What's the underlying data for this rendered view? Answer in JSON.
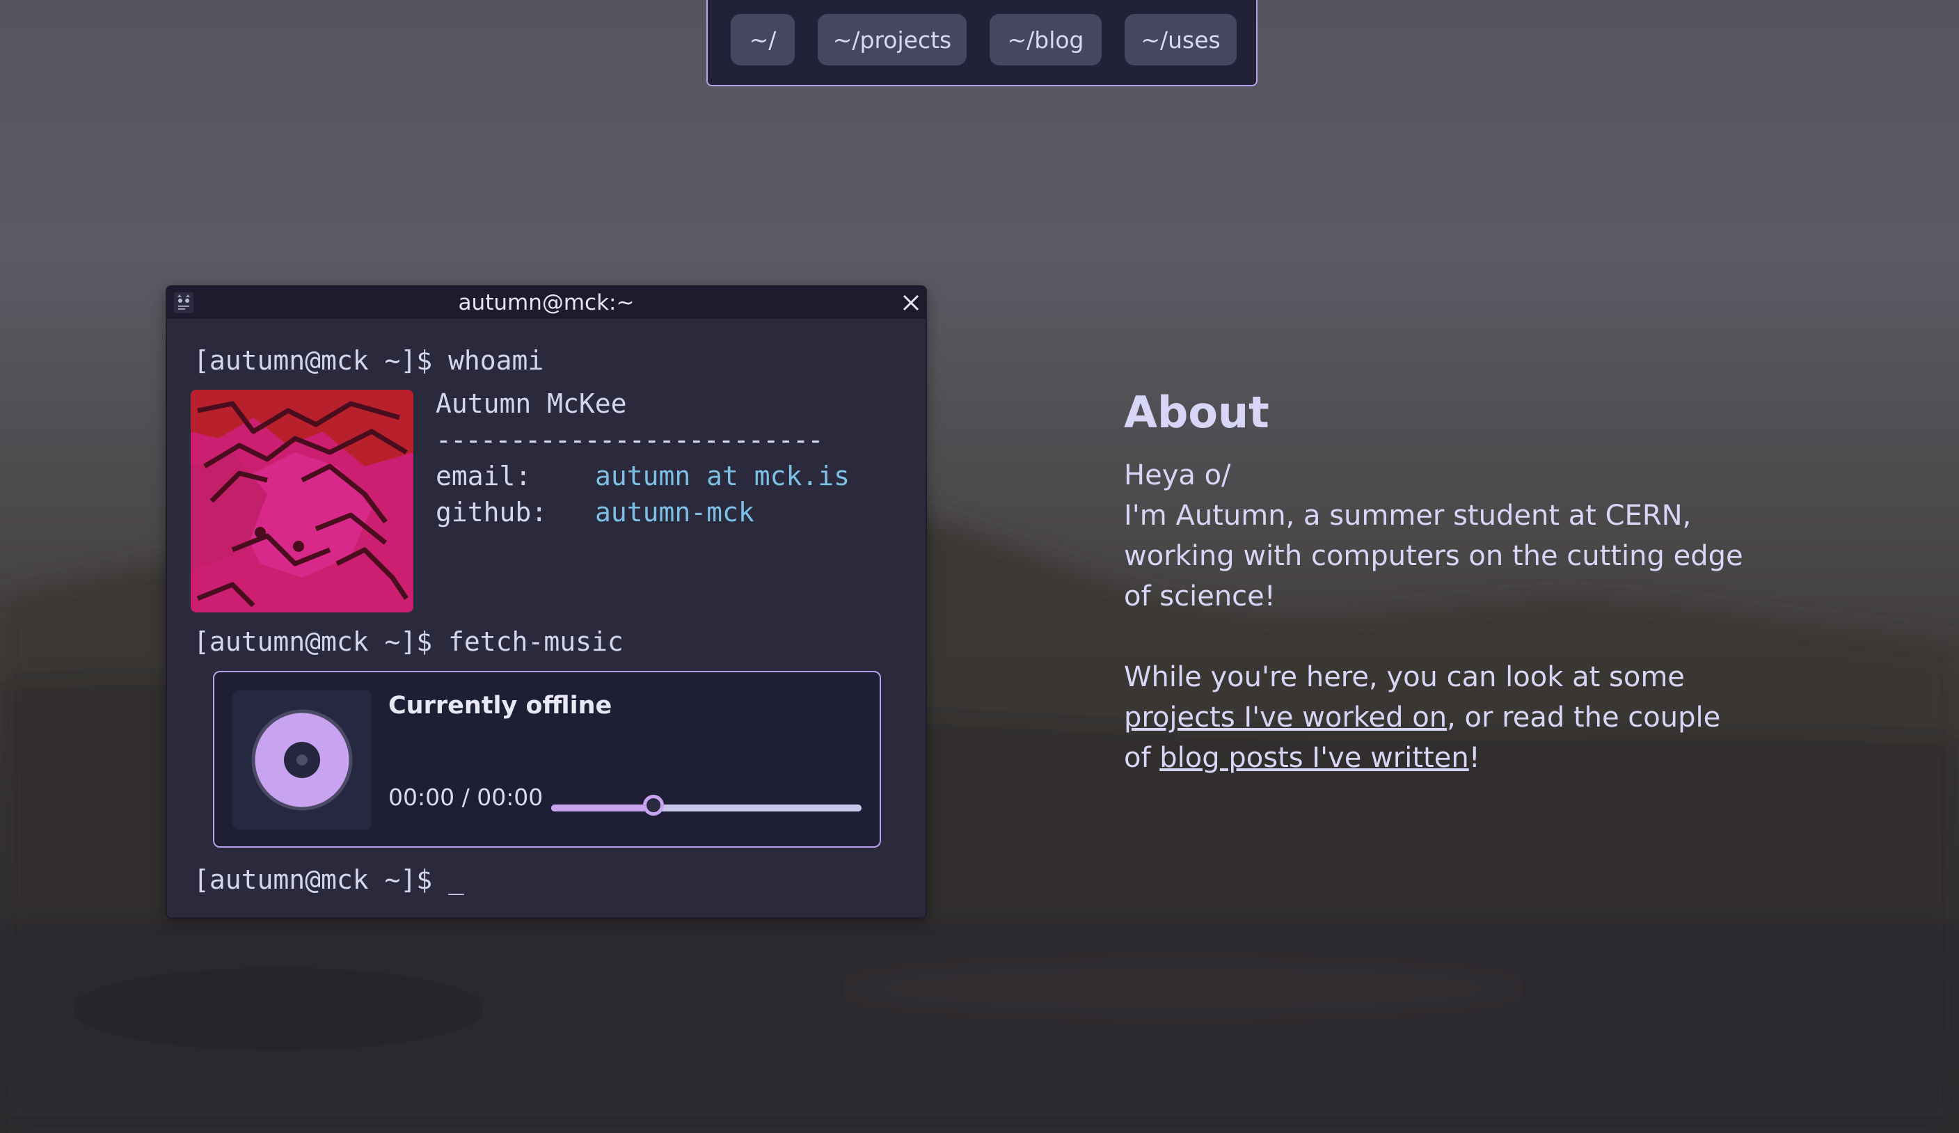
{
  "nav": {
    "home": "~/",
    "projects": "~/projects",
    "blog": "~/blog",
    "uses": "~/uses"
  },
  "terminal": {
    "title": "autumn@mck:~",
    "prompt1": "[autumn@mck ~]$ whoami",
    "name": "Autumn McKee",
    "separator": "--------------------------",
    "email_label": "email:",
    "email_value": "autumn at mck.is",
    "github_label": "github:",
    "github_value": "autumn-mck",
    "prompt2": "[autumn@mck ~]$ fetch-music",
    "prompt3": "[autumn@mck ~]$ _"
  },
  "music": {
    "status": "Currently offline",
    "time": "00:00 / 00:00",
    "progress": 0.33
  },
  "about": {
    "title": "About",
    "greeting": "Heya o/",
    "intro": "I'm Autumn, a summer student at CERN, working with computers on the cutting edge of science!",
    "p2_before": "While you're here, you can look at some ",
    "projects_link": "projects I've worked on",
    "p2_middle": ", or read the couple of ",
    "blog_link": "blog posts I've written",
    "p2_end": "!"
  },
  "icons": {
    "app": "terminal-cat-icon",
    "close": "close-icon",
    "disc": "disc-icon"
  },
  "colors": {
    "accent": "#b7a0ea",
    "link": "#7dc0e6",
    "text": "#d7d6f6",
    "panel": "#2b2a3c"
  }
}
